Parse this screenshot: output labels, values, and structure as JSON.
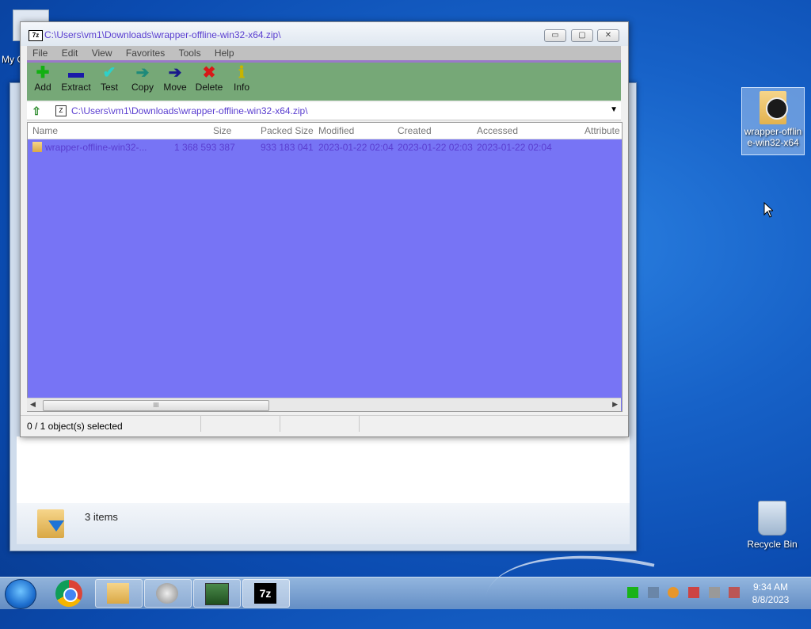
{
  "desktop": {
    "partial_icon_label": "My C",
    "zip_icon_label": "wrapper-offline-win32-x64",
    "recycle_bin_label": "Recycle Bin"
  },
  "explorer": {
    "items_count": "3 items"
  },
  "sevenzip": {
    "title": "C:\\Users\\vm1\\Downloads\\wrapper-offline-win32-x64.zip\\",
    "app_icon": "7z",
    "window_buttons": {
      "minimize": "▭",
      "maximize": "▢",
      "close": "✕"
    },
    "menu": [
      "File",
      "Edit",
      "View",
      "Favorites",
      "Tools",
      "Help"
    ],
    "toolbar": [
      {
        "label": "Add",
        "icon": "plus-icon",
        "glyph": "✚",
        "color": "#12b012"
      },
      {
        "label": "Extract",
        "icon": "minus-icon",
        "glyph": "▬",
        "color": "#1a1aa8"
      },
      {
        "label": "Test",
        "icon": "check-icon",
        "glyph": "✔",
        "color": "#2fd0c8"
      },
      {
        "label": "Copy",
        "icon": "copy-arrow-icon",
        "glyph": "➔",
        "color": "#1e8a7a"
      },
      {
        "label": "Move",
        "icon": "move-arrow-icon",
        "glyph": "➔",
        "color": "#1a1a8a"
      },
      {
        "label": "Delete",
        "icon": "delete-x-icon",
        "glyph": "✖",
        "color": "#d81818"
      },
      {
        "label": "Info",
        "icon": "info-icon",
        "glyph": "ℹ",
        "color": "#c8b400"
      }
    ],
    "address": "C:\\Users\\vm1\\Downloads\\wrapper-offline-win32-x64.zip\\",
    "columns": [
      "Name",
      "Size",
      "Packed Size",
      "Modified",
      "Created",
      "Accessed",
      "Attribute"
    ],
    "rows": [
      {
        "name": "wrapper-offline-win32-...",
        "size": "1 368 593 387",
        "packed": "933 183 041",
        "modified": "2023-01-22 02:04",
        "created": "2023-01-22 02:03",
        "accessed": "2023-01-22 02:04"
      }
    ],
    "scroll_left": "◀",
    "scroll_right": "▶",
    "scroll_grip": "III",
    "status": "0 / 1 object(s) selected"
  },
  "taskbar": {
    "time": "9:34 AM",
    "date": "8/8/2023",
    "items": [
      "windows-explorer",
      "vm-tool",
      "monitor-app",
      "7-zip"
    ],
    "active_app_label": "7z"
  },
  "colors": {
    "list_background": "#7774f5",
    "toolbar_background": "#76a877",
    "accent_text": "#5a3ed0"
  }
}
